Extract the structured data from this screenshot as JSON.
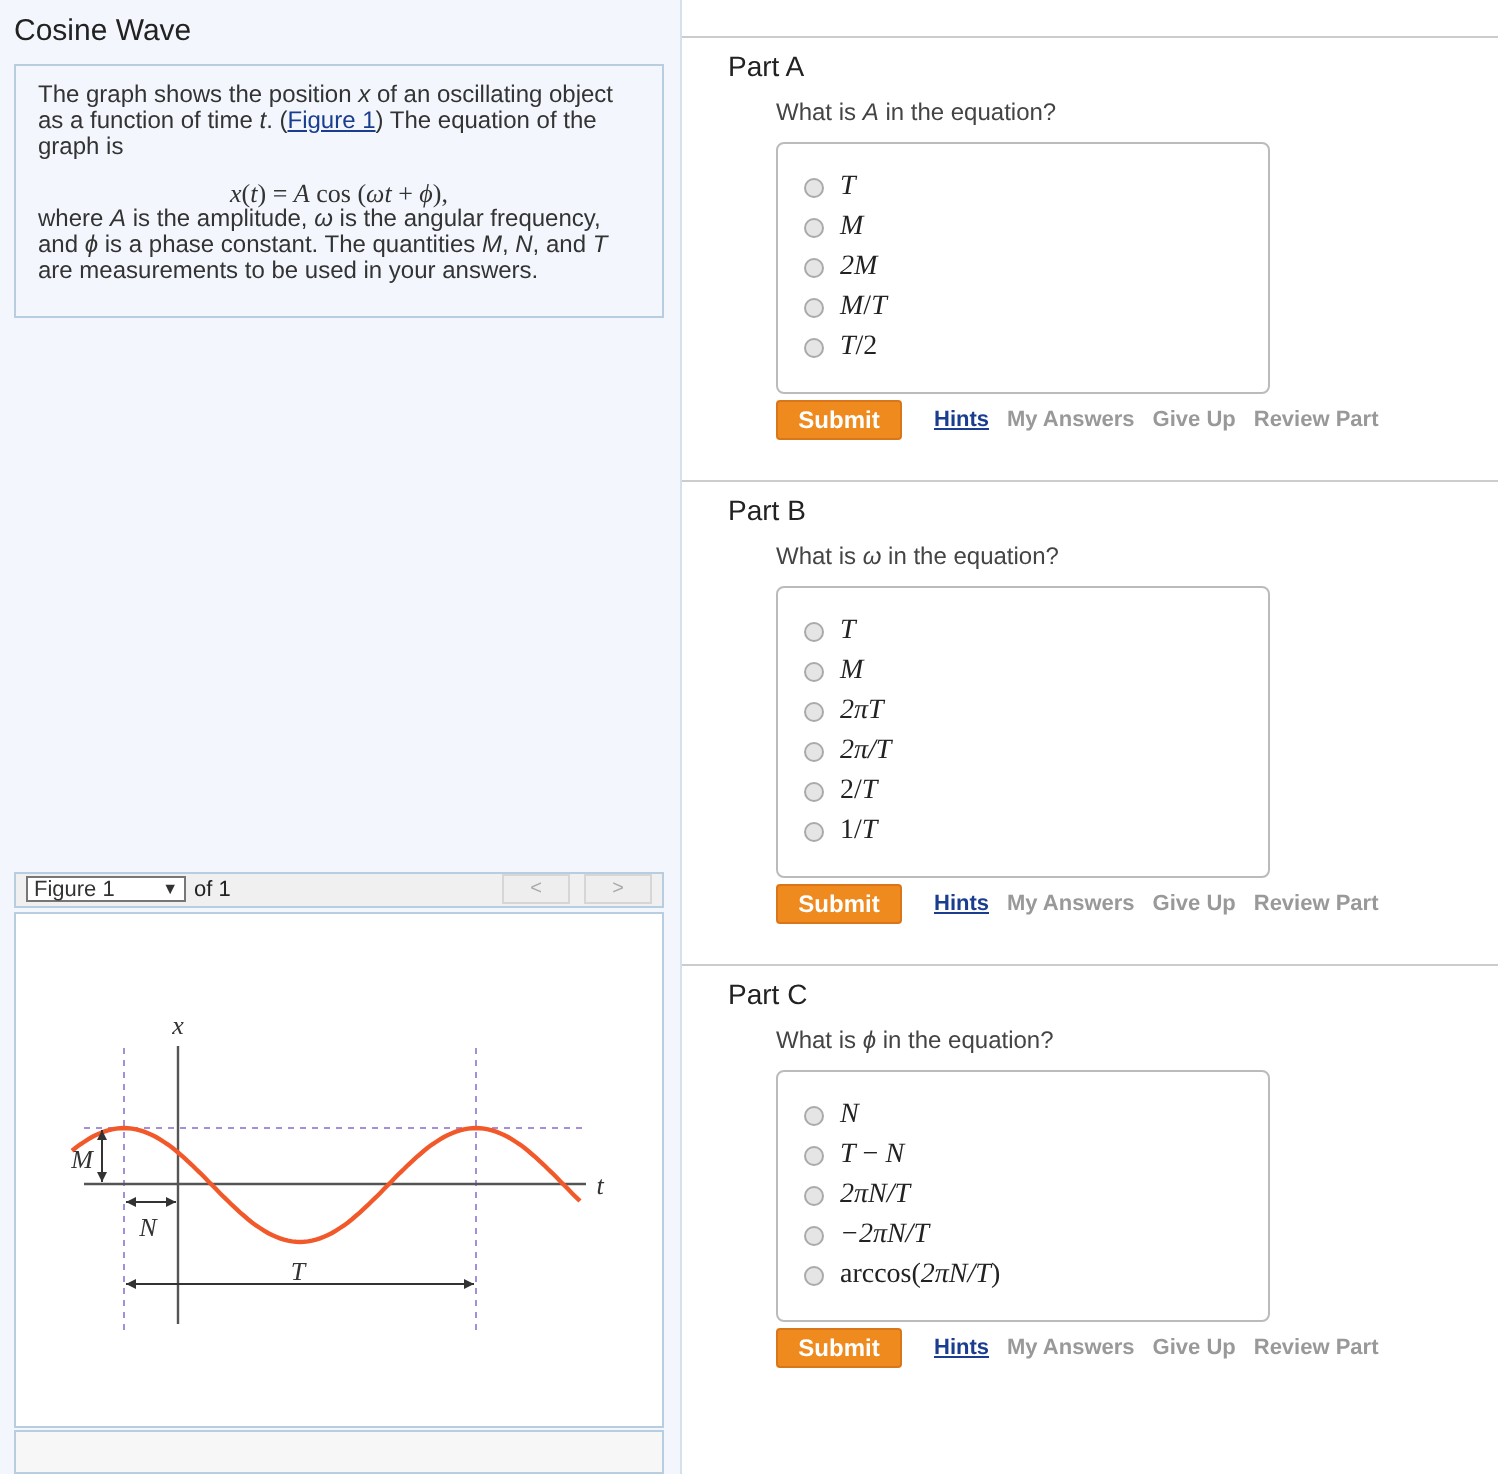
{
  "title": "Cosine Wave",
  "problem": {
    "intro_before": "The graph shows the position *x* of an oscillating object as a function of time *t*. (",
    "figure_link": "Figure 1",
    "intro_after": ") The equation of the graph is",
    "equation": "*x*(*t*) = *A* cos (*ωt* + *ϕ*),",
    "explanation": "where *A* is the amplitude, *ω* is the angular frequency, and *ϕ* is a phase constant. The quantities *M*, *N*, and *T* are measurements to be used in your answers."
  },
  "figure_toolbar": {
    "select_value": "Figure 1",
    "select_arrow": "▼",
    "count": "of 1",
    "prev": "<",
    "next": ">"
  },
  "figure": {
    "axis_x": "x",
    "axis_t": "t",
    "label_m": "M",
    "label_n": "N",
    "label_t": "T"
  },
  "parts": [
    {
      "title": "Part A",
      "question": "What is *A* in the equation?",
      "options": [
        {
          "label": "*T*",
          "selected": false
        },
        {
          "label": "*M*",
          "selected": false
        },
        {
          "label": "*2M*",
          "selected": false
        },
        {
          "label": "*M*/*T*",
          "selected": false
        },
        {
          "label": "*T*/2",
          "selected": false
        }
      ],
      "submit": "Submit",
      "links": [
        "Hints",
        "My Answers",
        "Give Up",
        "Review Part"
      ]
    },
    {
      "title": "Part B",
      "question": "What is *ω* in the equation?",
      "options": [
        {
          "label": "*T*",
          "selected": false
        },
        {
          "label": "*M*",
          "selected": false
        },
        {
          "label": "*2πT*",
          "selected": false
        },
        {
          "label": "*2π/T*",
          "selected": false
        },
        {
          "label": "2/*T*",
          "selected": false
        },
        {
          "label": "1/*T*",
          "selected": false
        }
      ],
      "submit": "Submit",
      "links": [
        "Hints",
        "My Answers",
        "Give Up",
        "Review Part"
      ]
    },
    {
      "title": "Part C",
      "question": "What is *ϕ* in the equation?",
      "options": [
        {
          "label": "*N*",
          "selected": false
        },
        {
          "label": "*T* − *N*",
          "selected": false
        },
        {
          "label": "*2πN/T*",
          "selected": false
        },
        {
          "label": "*−2πN/T*",
          "selected": false
        },
        {
          "label": "arccos(*2πN/T*)",
          "selected": false
        }
      ],
      "submit": "Submit",
      "links": [
        "Hints",
        "My Answers",
        "Give Up",
        "Review Part"
      ]
    }
  ]
}
